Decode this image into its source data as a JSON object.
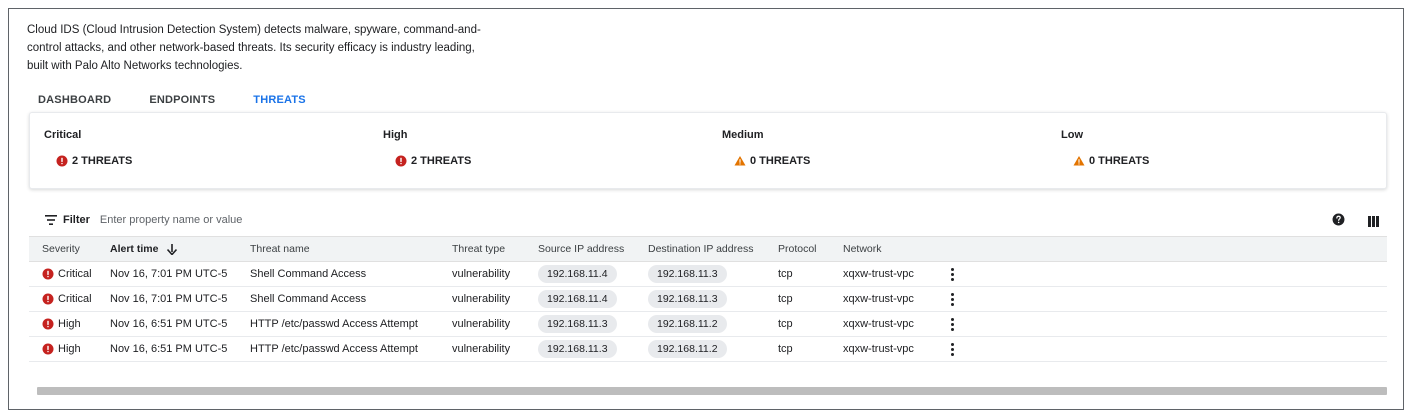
{
  "intro_text": "Cloud IDS (Cloud Intrusion Detection System) detects malware, spyware, command-and-control attacks, and other network-based threats. Its security efficacy is industry leading, built with Palo Alto Networks technologies.",
  "tabs": [
    {
      "label": "DASHBOARD",
      "active": false
    },
    {
      "label": "ENDPOINTS",
      "active": false
    },
    {
      "label": "THREATS",
      "active": true
    }
  ],
  "summary": [
    {
      "title": "Critical",
      "value": "2 THREATS",
      "icon": "error-icon"
    },
    {
      "title": "High",
      "value": "2 THREATS",
      "icon": "error-icon"
    },
    {
      "title": "Medium",
      "value": "0 THREATS",
      "icon": "warning-icon"
    },
    {
      "title": "Low",
      "value": "0 THREATS",
      "icon": "warning-icon"
    }
  ],
  "filter": {
    "label": "Filter",
    "placeholder": "Enter property name or value"
  },
  "table": {
    "columns": [
      "Severity",
      "Alert time",
      "Threat name",
      "Threat type",
      "Source IP address",
      "Destination IP address",
      "Protocol",
      "Network"
    ],
    "sort_column": "Alert time",
    "rows": [
      {
        "severity": "Critical",
        "alert_time": "Nov 16, 7:01 PM UTC-5",
        "threat_name": "Shell Command Access",
        "threat_type": "vulnerability",
        "source_ip": "192.168.11.4",
        "dest_ip": "192.168.11.3",
        "protocol": "tcp",
        "network": "xqxw-trust-vpc"
      },
      {
        "severity": "Critical",
        "alert_time": "Nov 16, 7:01 PM UTC-5",
        "threat_name": "Shell Command Access",
        "threat_type": "vulnerability",
        "source_ip": "192.168.11.4",
        "dest_ip": "192.168.11.3",
        "protocol": "tcp",
        "network": "xqxw-trust-vpc"
      },
      {
        "severity": "High",
        "alert_time": "Nov 16, 6:51 PM UTC-5",
        "threat_name": "HTTP /etc/passwd Access Attempt",
        "threat_type": "vulnerability",
        "source_ip": "192.168.11.3",
        "dest_ip": "192.168.11.2",
        "protocol": "tcp",
        "network": "xqxw-trust-vpc"
      },
      {
        "severity": "High",
        "alert_time": "Nov 16, 6:51 PM UTC-5",
        "threat_name": "HTTP /etc/passwd Access Attempt",
        "threat_type": "vulnerability",
        "source_ip": "192.168.11.3",
        "dest_ip": "192.168.11.2",
        "protocol": "tcp",
        "network": "xqxw-trust-vpc"
      }
    ]
  },
  "colors": {
    "accent": "#1a73e8",
    "critical": "#c5221f",
    "warning": "#e37400"
  }
}
